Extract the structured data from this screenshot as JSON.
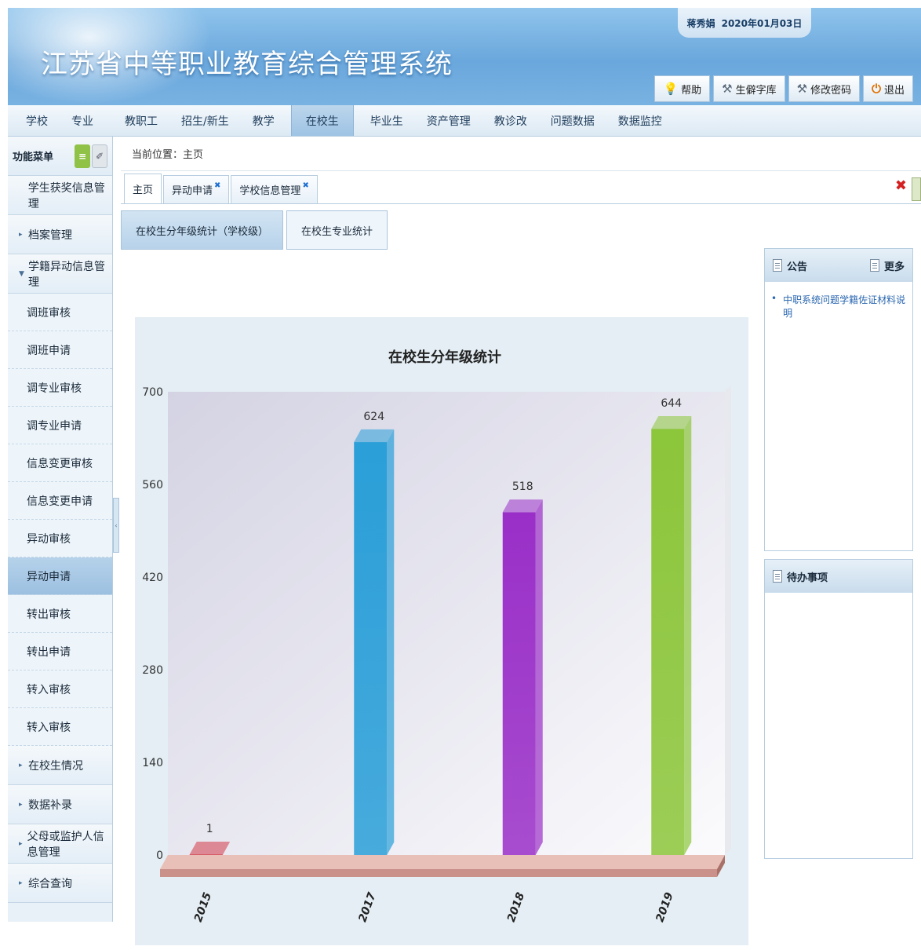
{
  "header": {
    "title": "江苏省中等职业教育综合管理系统",
    "user": "蒋秀娟",
    "date": "2020年01月03日",
    "buttons": [
      {
        "label": "帮助",
        "icon": "lightbulb-icon"
      },
      {
        "label": "生僻字库",
        "icon": "tools-icon"
      },
      {
        "label": "修改密码",
        "icon": "tools-icon"
      },
      {
        "label": "退出",
        "icon": "power-icon"
      }
    ]
  },
  "nav": {
    "items": [
      "学校",
      "专业",
      "教职工",
      "招生/新生",
      "教学",
      "在校生",
      "毕业生",
      "资产管理",
      "教诊改",
      "问题数据",
      "数据监控"
    ],
    "active": "在校生"
  },
  "sidebar": {
    "title": "功能菜单",
    "top_items": [
      "学生获奖信息管理",
      "档案管理",
      "学籍异动信息管理"
    ],
    "sub_items": [
      "调班审核",
      "调班申请",
      "调专业审核",
      "调专业申请",
      "信息变更审核",
      "信息变更申请",
      "异动审核",
      "异动申请",
      "转出审核",
      "转出申请",
      "转入审核",
      "转入审核"
    ],
    "active_sub": "异动申请",
    "bottom_items": [
      "在校生情况",
      "数据补录",
      "父母或监护人信息管理",
      "综合查询"
    ]
  },
  "breadcrumb": "当前位置：主页",
  "tabs": [
    {
      "label": "主页",
      "closable": false
    },
    {
      "label": "异动申请",
      "closable": true
    },
    {
      "label": "学校信息管理",
      "closable": true
    }
  ],
  "subtabs": [
    "在校生分年级统计（学校级）",
    "在校生专业统计"
  ],
  "chart_data": {
    "type": "bar",
    "title": "在校生分年级统计",
    "categories": [
      "2015",
      "2017",
      "2018",
      "2019"
    ],
    "values": [
      1,
      624,
      518,
      644
    ],
    "ylim": [
      0,
      700
    ],
    "yticks": [
      0,
      140,
      280,
      420,
      560,
      700
    ],
    "colors": [
      "#d33a48",
      "#2a9fd8",
      "#9a2fc8",
      "#8cc63a"
    ],
    "xlabel": "",
    "ylabel": ""
  },
  "notice_panel": {
    "title": "公告",
    "more": "更多",
    "items": [
      "中职系统问题学籍佐证材料说明"
    ]
  },
  "todo_panel": {
    "title": "待办事项"
  }
}
